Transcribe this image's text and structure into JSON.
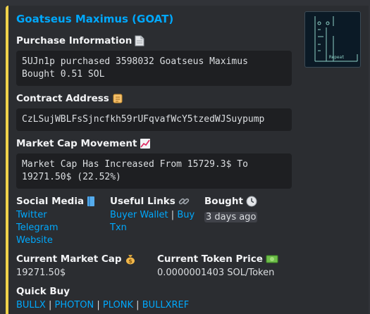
{
  "embed": {
    "accent_color": "#f0d24a",
    "title": "Goatseus Maximus (GOAT)",
    "thumbnail": {
      "caption": "Repeat"
    }
  },
  "purchase": {
    "label": "Purchase Information",
    "icon": "page-icon",
    "text": "5UJn1p purchased 3598032 Goatseus Maximus Bought 0.51 SOL"
  },
  "contract": {
    "label": "Contract Address",
    "icon": "scroll-icon",
    "text": "CzLSujWBLFsSjncfkh59rUFqvafWcY5tzedWJSuypump"
  },
  "market_cap_movement": {
    "label": "Market Cap Movement",
    "icon": "chart-increasing-icon",
    "text": "Market Cap Has Increased From 15729.3$ To 19271.50$ (22.52%)"
  },
  "social": {
    "label": "Social Media",
    "icon": "blue-book-icon",
    "links": [
      "Twitter",
      "Telegram",
      "Website"
    ]
  },
  "useful_links": {
    "label": "Useful Links",
    "icon": "link-icon",
    "buyer_wallet": "Buyer Wallet",
    "separator": "|",
    "buy_txn_1": "Buy",
    "buy_txn_2": "Txn"
  },
  "bought": {
    "label": "Bought",
    "icon": "clock-icon",
    "value": "3 days ago"
  },
  "current_market_cap": {
    "label": "Current Market Cap",
    "icon": "money-bag-icon",
    "value": "19271.50$"
  },
  "current_token_price": {
    "label": "Current Token Price",
    "icon": "dollar-banknote-icon",
    "value": "0.0000001403 SOL/Token"
  },
  "quick_buy": {
    "label": "Quick Buy",
    "links": [
      "BULLX",
      "PHOTON",
      "PLONK",
      "BULLXREF"
    ],
    "separator": "|"
  }
}
